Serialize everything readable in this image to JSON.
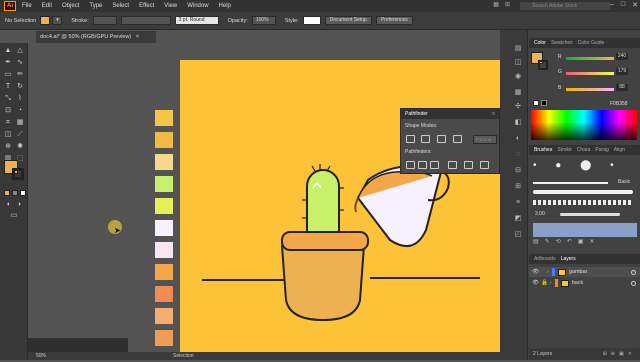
{
  "menubar": {
    "logo": "Ai",
    "items": [
      "File",
      "Edit",
      "Object",
      "Type",
      "Select",
      "Effect",
      "View",
      "Window",
      "Help"
    ],
    "search_placeholder": "Search Adobe Stock"
  },
  "controlbar": {
    "selection_label": "No Selection",
    "fill_color": "#f0b050",
    "stroke_label": "Stroke:",
    "stroke_weight": "3 pt. Round",
    "opacity_label": "Opacity:",
    "opacity_value": "100%",
    "style_label": "Style:",
    "document_setup": "Document Setup",
    "preferences": "Preferences"
  },
  "document_tab": {
    "title": "doc4.ai* @ 50% (RGB/GPU Preview)"
  },
  "swatches": [
    "#f7c545",
    "#f2ba43",
    "#f5d98a",
    "#c8f06a",
    "#e6f15a",
    "#f6f0ff",
    "#f9e4f4",
    "#f3a64a",
    "#f28c57",
    "#f4ad73",
    "#ef9c55"
  ],
  "statusbar": {
    "zoom": "50%",
    "tool": "Selection"
  },
  "color_panel": {
    "tabs": [
      "Color",
      "Swatches",
      "Color Guide"
    ],
    "r": "240",
    "g": "179",
    "b": "88",
    "hex": "F0B358"
  },
  "brushes_panel": {
    "tabs": [
      "Brushes",
      "Stroke",
      "Chara",
      "Parag",
      "Align"
    ],
    "basic_label": "Basic",
    "size_label": "3.00"
  },
  "pathfinder": {
    "title": "Pathfinder",
    "shape_modes": "Shape Modes:",
    "expand": "Expand",
    "pathfinders": "Pathfinders:"
  },
  "layers_panel": {
    "tabs": [
      "Artboards",
      "Layers"
    ],
    "layers": [
      {
        "name": "gambar",
        "color": "#4a78ff"
      },
      {
        "name": "back",
        "color": "#ff8c00"
      }
    ],
    "count": "2 Layers"
  }
}
